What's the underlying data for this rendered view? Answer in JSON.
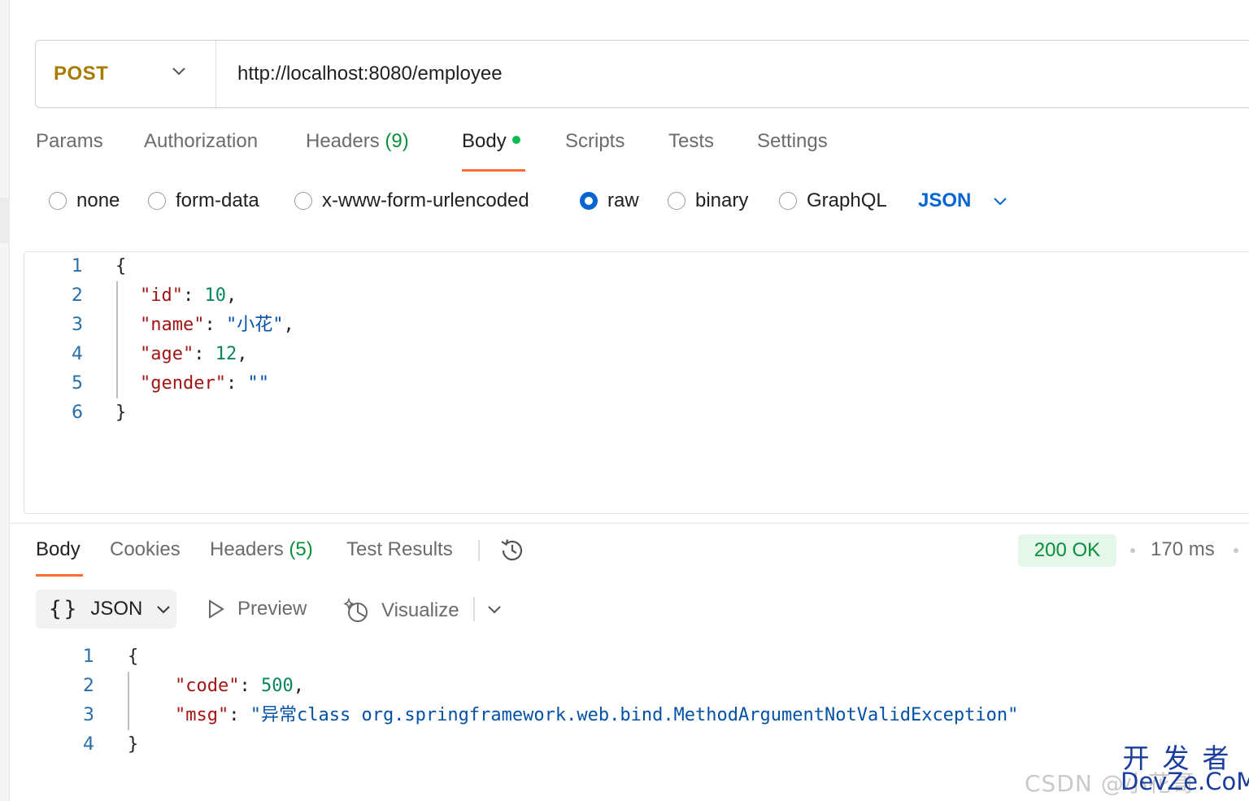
{
  "request": {
    "method": "POST",
    "url": "http://localhost:8080/employee"
  },
  "request_tabs": {
    "params": "Params",
    "authorization": "Authorization",
    "headers_label": "Headers",
    "headers_count": "(9)",
    "body": "Body",
    "scripts": "Scripts",
    "tests": "Tests",
    "settings": "Settings",
    "active": "Body"
  },
  "body_types": {
    "options": [
      "none",
      "form-data",
      "x-www-form-urlencoded",
      "raw",
      "binary",
      "GraphQL"
    ],
    "selected": "raw",
    "format": "JSON"
  },
  "request_body": {
    "line_numbers": [
      "1",
      "2",
      "3",
      "4",
      "5",
      "6"
    ],
    "open_brace": "{",
    "close_brace": "}",
    "fields": [
      {
        "key": "\"id\"",
        "value": "10",
        "value_type": "number",
        "comma": ","
      },
      {
        "key": "\"name\"",
        "value": "\"小花\"",
        "value_type": "string",
        "comma": ","
      },
      {
        "key": "\"age\"",
        "value": "12",
        "value_type": "number",
        "comma": ","
      },
      {
        "key": "\"gender\"",
        "value": "\"\"",
        "value_type": "string",
        "comma": ""
      }
    ]
  },
  "response_tabs": {
    "body": "Body",
    "cookies": "Cookies",
    "headers_label": "Headers",
    "headers_count": "(5)",
    "test_results": "Test Results",
    "active": "Body"
  },
  "response_meta": {
    "status": "200 OK",
    "time": "170 ms"
  },
  "response_toolbar": {
    "format": "JSON",
    "preview": "Preview",
    "visualize": "Visualize"
  },
  "response_body": {
    "line_numbers": [
      "1",
      "2",
      "3",
      "4"
    ],
    "open_brace": "{",
    "close_brace": "}",
    "fields": [
      {
        "key": "\"code\"",
        "value": "500",
        "value_type": "number",
        "comma": ","
      },
      {
        "key": "\"msg\"",
        "value": "\"异常class org.springframework.web.bind.MethodArgumentNotValidException\"",
        "value_type": "string",
        "comma": ""
      }
    ]
  },
  "watermark": {
    "left_text": "CSDN @小花哥",
    "logo_cn": "开发者",
    "logo_en": "DevZe.CoM"
  },
  "colors": {
    "method": "#a87b00",
    "accent_tab": "#ff6c37",
    "radio_selected": "#0265d2",
    "status_ok_bg": "#e5f6ea",
    "status_ok_text": "#0a8f3c"
  }
}
